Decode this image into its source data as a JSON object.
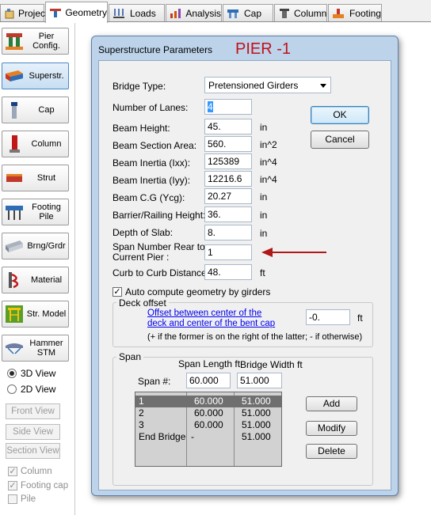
{
  "tabs": [
    {
      "label": "Project",
      "icon": "project-icon"
    },
    {
      "label": "Geometry",
      "icon": "geometry-icon",
      "active": true
    },
    {
      "label": "Loads",
      "icon": "loads-icon"
    },
    {
      "label": "Analysis",
      "icon": "analysis-icon"
    },
    {
      "label": "Cap",
      "icon": "cap-icon"
    },
    {
      "label": "Column",
      "icon": "column-icon"
    },
    {
      "label": "Footing",
      "icon": "footing-icon"
    }
  ],
  "sidebar": {
    "buttons": [
      {
        "label": "Pier Config.",
        "icon": "pier-config-icon"
      },
      {
        "label": "Superstr.",
        "icon": "superstructure-icon",
        "active": true
      },
      {
        "label": "Cap",
        "icon": "cap-icon"
      },
      {
        "label": "Column",
        "icon": "column-icon"
      },
      {
        "label": "Strut",
        "icon": "strut-icon"
      },
      {
        "label": "Footing Pile",
        "icon": "footing-pile-icon"
      },
      {
        "label": "Brng/Grdr",
        "icon": "bearing-girder-icon"
      },
      {
        "label": "Material",
        "icon": "material-icon"
      },
      {
        "label": "Str. Model",
        "icon": "structure-model-icon"
      },
      {
        "label": "Hammer STM",
        "icon": "hammer-stm-icon"
      }
    ],
    "view_3d": "3D View",
    "view_2d": "2D View",
    "front_view": "Front View",
    "side_view": "Side View",
    "section_view": "Section View",
    "chk_column": "Column",
    "chk_footing_cap": "Footing cap",
    "chk_pile": "Pile"
  },
  "dialog": {
    "title": "Superstructure Parameters",
    "pier_label": "PIER -1",
    "bridge_type_label": "Bridge Type:",
    "bridge_type_value": "Pretensioned Girders",
    "fields": [
      {
        "label": "Number of Lanes:",
        "value": "4",
        "unit": ""
      },
      {
        "label": "Beam Height:",
        "value": "45.",
        "unit": "in"
      },
      {
        "label": "Beam Section Area:",
        "value": "560.",
        "unit": "in^2"
      },
      {
        "label": "Beam Inertia (Ixx):",
        "value": "125389",
        "unit": "in^4"
      },
      {
        "label": "Beam Inertia (Iyy):",
        "value": "12216.6",
        "unit": "in^4"
      },
      {
        "label": "Beam C.G (Ycg):",
        "value": "20.27",
        "unit": "in"
      },
      {
        "label": "Barrier/Railing Height:",
        "value": "36.",
        "unit": "in"
      },
      {
        "label": "Depth of Slab:",
        "value": "8.",
        "unit": "in"
      }
    ],
    "span_number_label_1": "Span Number Rear to",
    "span_number_label_2": "Current Pier :",
    "span_number_value": "1",
    "curb_label": "Curb to Curb Distance:",
    "curb_value": "48.",
    "curb_unit": "ft",
    "ok": "OK",
    "cancel": "Cancel",
    "auto_compute": "Auto compute geometry by girders",
    "deck_offset_title": "Deck offset",
    "offset_link_1": "Offset between center of the",
    "offset_link_2": "deck and center of the bent cap",
    "offset_value": "-0.",
    "offset_unit": "ft",
    "offset_note": "(+ if the former is on the right of the latter; - if otherwise)",
    "span_group_title": "Span",
    "span_length_hdr": "Span Length ft",
    "bridge_width_hdr": "Bridge Width ft",
    "span_num_label": "Span #:",
    "span_length_input": "60.000",
    "bridge_width_input": "51.000",
    "span_rows": [
      {
        "span": "1",
        "length": "60.000",
        "width": "51.000"
      },
      {
        "span": "2",
        "length": "60.000",
        "width": "51.000"
      },
      {
        "span": "3",
        "length": "60.000",
        "width": "51.000"
      },
      {
        "span": "End Bridge",
        "length": "-",
        "width": "51.000"
      }
    ],
    "add": "Add",
    "modify": "Modify",
    "delete": "Delete"
  },
  "colors": {
    "pier_label": "#c0121b",
    "annotation_arrow": "#b01818",
    "dialog_frame": "#bcd3ea",
    "selected_row": "#6f6f6f"
  }
}
